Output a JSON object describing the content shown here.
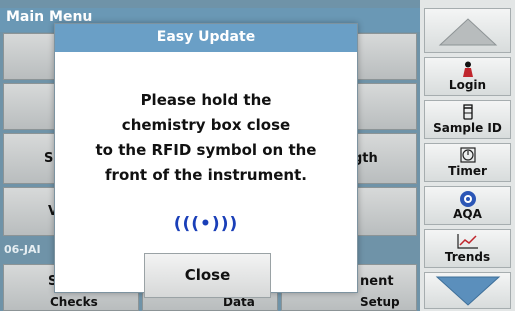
{
  "main_menu": {
    "title": "Main Menu",
    "left_labels": [
      "Si",
      "V",
      "S"
    ],
    "right_labels": [
      "gth",
      "nent"
    ],
    "bottom_partials": [
      "Checks",
      "Data",
      "Setup"
    ],
    "date": "06-JAI"
  },
  "dialog": {
    "title": "Easy Update",
    "message_lines": [
      "Please hold the",
      "chemistry box close",
      "to the RFID symbol on the",
      "front of the instrument."
    ],
    "rfid_symbol": "(((•)))",
    "close_label": "Close"
  },
  "side_panel": {
    "login": "Login",
    "sample_id": "Sample ID",
    "timer": "Timer",
    "aqa": "AQA",
    "trends": "Trends"
  },
  "colors": {
    "title_bar": "#6a98b5",
    "dialog_title_bar": "#6a9fc6",
    "rfid_blue": "#1a3fb8",
    "scroll_arrow": "#5b8fbc"
  }
}
